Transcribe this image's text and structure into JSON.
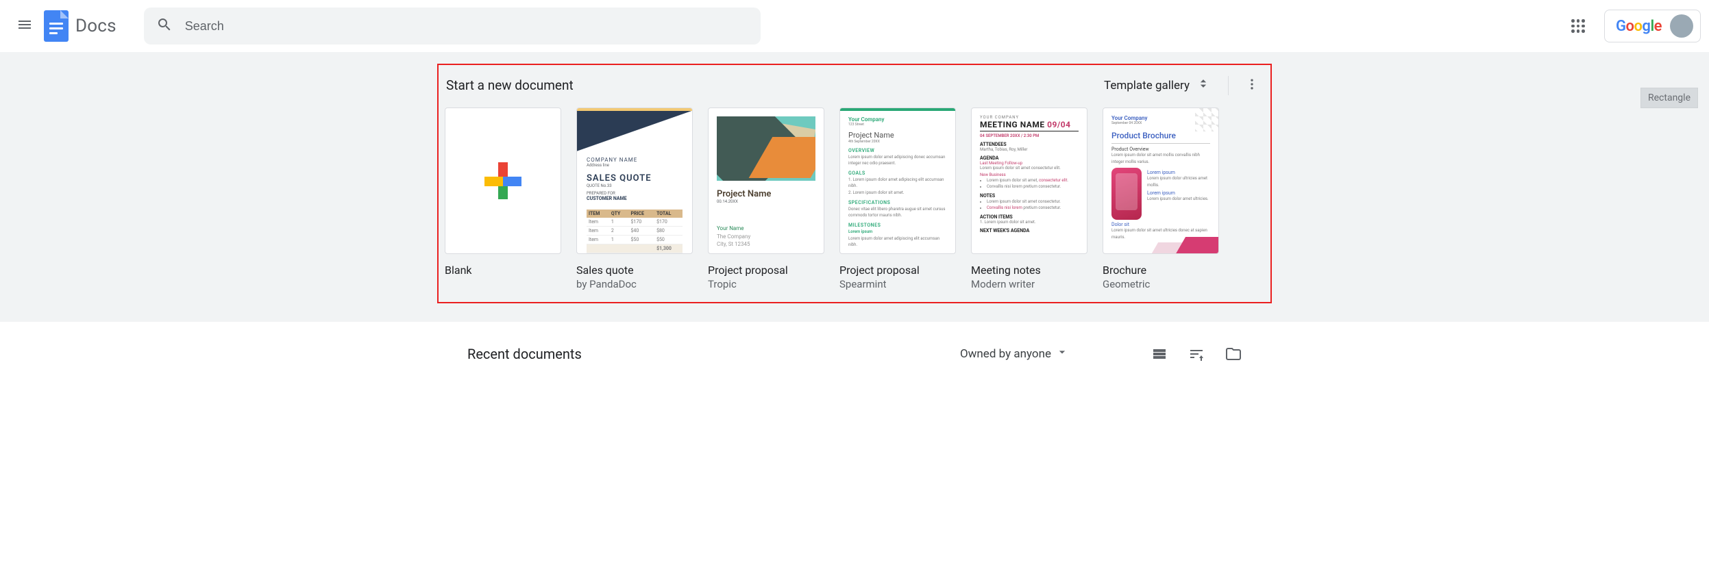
{
  "header": {
    "app_name": "Docs",
    "search_placeholder": "Search",
    "google_word": "Google"
  },
  "templates": {
    "section_title": "Start a new document",
    "gallery_label": "Template gallery",
    "cards": [
      {
        "title": "Blank",
        "subtitle": ""
      },
      {
        "title": "Sales quote",
        "subtitle": "by PandaDoc"
      },
      {
        "title": "Project proposal",
        "subtitle": "Tropic"
      },
      {
        "title": "Project proposal",
        "subtitle": "Spearmint"
      },
      {
        "title": "Meeting notes",
        "subtitle": "Modern writer"
      },
      {
        "title": "Brochure",
        "subtitle": "Geometric"
      }
    ]
  },
  "recent": {
    "title": "Recent documents",
    "filter_label": "Owned by anyone"
  },
  "annotation": {
    "label": "Rectangle"
  }
}
